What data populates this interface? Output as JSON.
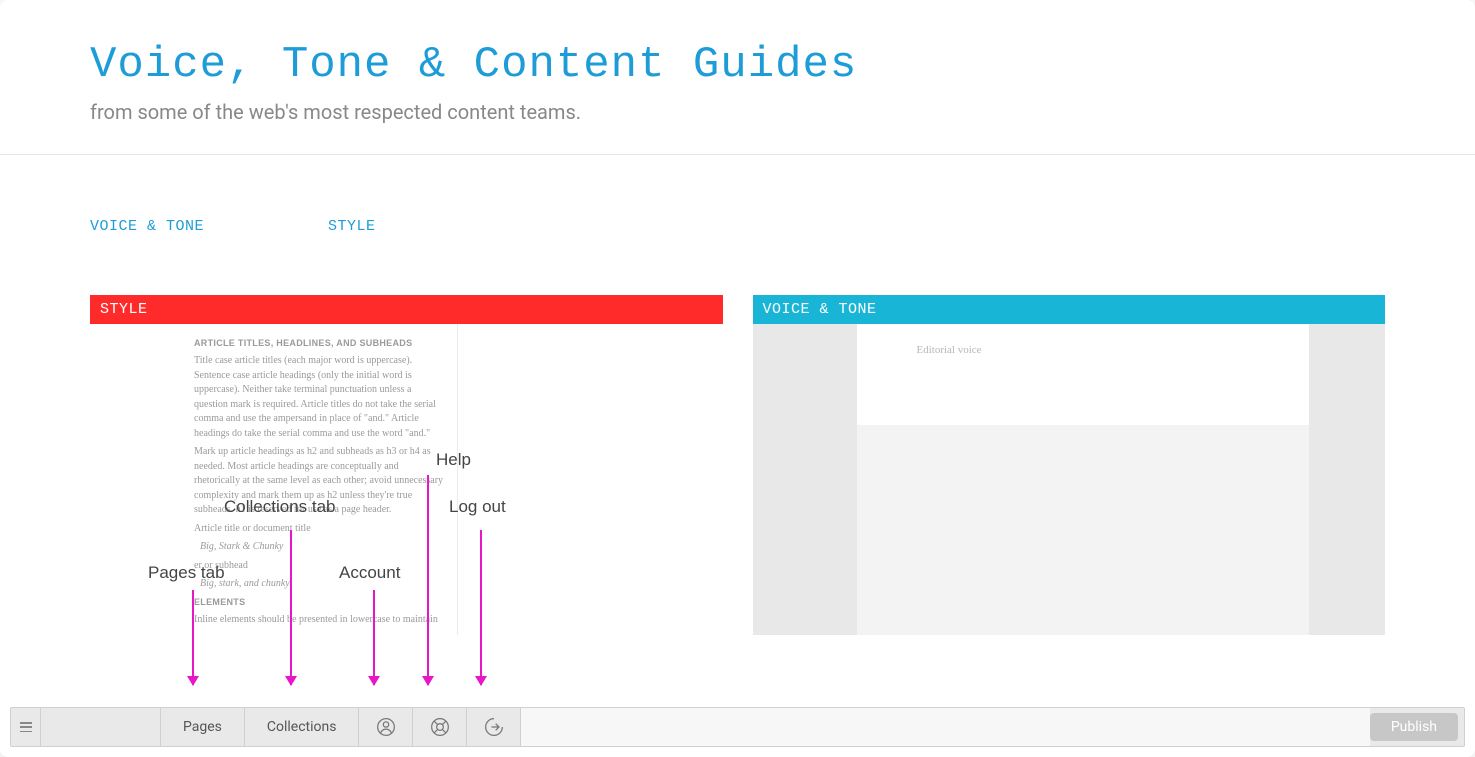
{
  "header": {
    "title": "Voice, Tone & Content Guides",
    "subtitle": "from some of the web's most respected content teams."
  },
  "nav": {
    "items": [
      {
        "label": "VOICE & TONE"
      },
      {
        "label": "STYLE"
      }
    ]
  },
  "panels": {
    "style": {
      "header": "STYLE",
      "section_heading": "ARTICLE TITLES, HEADLINES, AND SUBHEADS",
      "para1": "Title case article titles (each major word is uppercase). Sentence case article headings (only the initial word is uppercase). Neither take terminal punctuation unless a question mark is required. Article titles do not take the serial comma and use the ampersand in place of \"and.\" Article headings do take the serial comma and use the word \"and.\"",
      "para2": "Mark up article headings as h2 and subheads as h3 or h4 as needed. Most article headings are conceptually and rhetorically at the same level as each other; avoid unnecessary complexity and mark them up as h2 unless they're true subheads. h1 is reserved for use as a page header.",
      "label_title": "Article title or document title",
      "example_title": "Big, Stark & Chunky",
      "label_head": "er or subhead",
      "example_head": "Big, stark, and chunky",
      "section_elements": "ELEMENTS",
      "para3": "Inline elements should be presented in lowercase to maintain"
    },
    "voice": {
      "header": "VOICE & TONE",
      "body_label": "Editorial voice"
    }
  },
  "annotations": {
    "help": "Help",
    "collections_tab": "Collections tab",
    "logout": "Log out",
    "pages_tab": "Pages tab",
    "account": "Account"
  },
  "bottombar": {
    "pages": "Pages",
    "collections": "Collections",
    "publish": "Publish"
  }
}
